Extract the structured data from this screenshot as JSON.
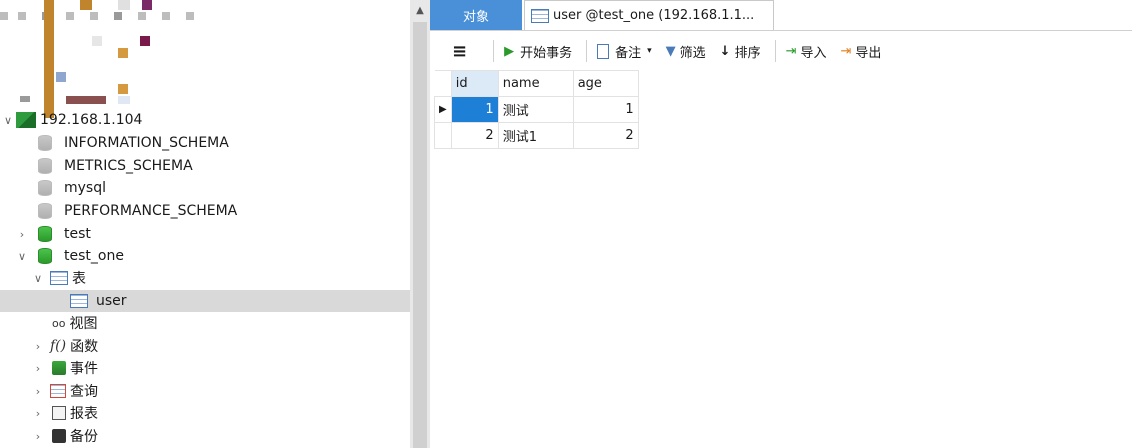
{
  "navigator": {
    "connection": "192.168.1.104",
    "databases": [
      {
        "name": "INFORMATION_SCHEMA"
      },
      {
        "name": "METRICS_SCHEMA"
      },
      {
        "name": "mysql"
      },
      {
        "name": "PERFORMANCE_SCHEMA"
      },
      {
        "name": "test"
      },
      {
        "name": "test_one"
      }
    ],
    "groups": {
      "tables": "表",
      "table_user": "user",
      "views": "视图",
      "functions": "函数",
      "events": "事件",
      "queries": "查询",
      "reports": "报表",
      "backups": "备份"
    }
  },
  "tabs": {
    "objects": "对象",
    "active": "user @test_one (192.168.1.1..."
  },
  "toolbar": {
    "begin_transaction": "开始事务",
    "memo": "备注",
    "filter": "筛选",
    "sort": "排序",
    "import": "导入",
    "export": "导出"
  },
  "grid": {
    "columns": [
      "id",
      "name",
      "age"
    ],
    "rows": [
      {
        "id": "1",
        "name": "测试",
        "age": "1"
      },
      {
        "id": "2",
        "name": "测试1",
        "age": "2"
      }
    ]
  },
  "colors": {
    "accent": "#4a90d9",
    "selected_cell": "#1e7fd6",
    "db_green": "#2a9a2a"
  }
}
